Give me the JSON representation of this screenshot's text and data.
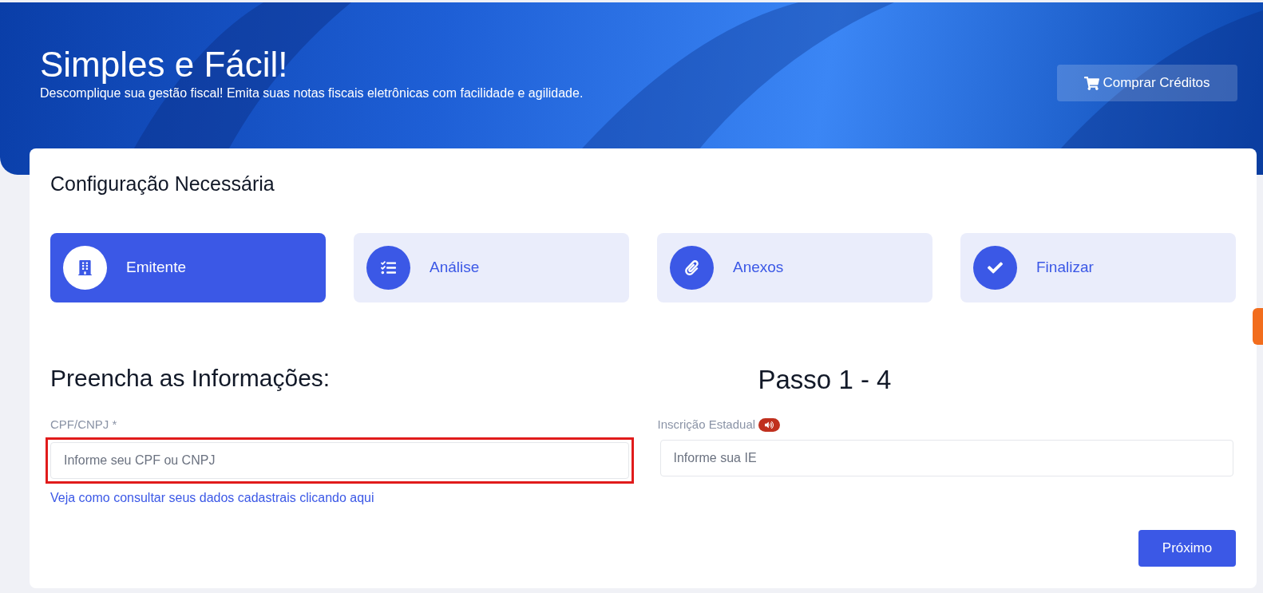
{
  "header": {
    "title": "Simples e Fácil!",
    "subtitle": "Descomplique sua gestão fiscal! Emita suas notas fiscais eletrônicas com facilidade e agilidade.",
    "buy_button": "Comprar Créditos"
  },
  "card": {
    "title": "Configuração Necessária",
    "steps": [
      {
        "label": "Emitente",
        "kind": "building",
        "selected": true
      },
      {
        "label": "Análise",
        "kind": "checklist",
        "selected": false
      },
      {
        "label": "Anexos",
        "kind": "clip",
        "selected": false
      },
      {
        "label": "Finalizar",
        "kind": "check",
        "selected": false
      }
    ],
    "form_title": "Preencha as Informações:",
    "step_counter": "Passo 1 - 4",
    "fields": [
      {
        "label": "CPF/CNPJ *",
        "placeholder": "Informe seu CPF ou CNPJ",
        "highlighted": true,
        "help_link": "Veja como consultar seus dados cadastrais clicando aqui",
        "audio_badge": false
      },
      {
        "label": "Inscrição Estadual",
        "placeholder": "Informe sua IE",
        "highlighted": false,
        "audio_badge": true
      }
    ],
    "next_button": "Próximo"
  }
}
